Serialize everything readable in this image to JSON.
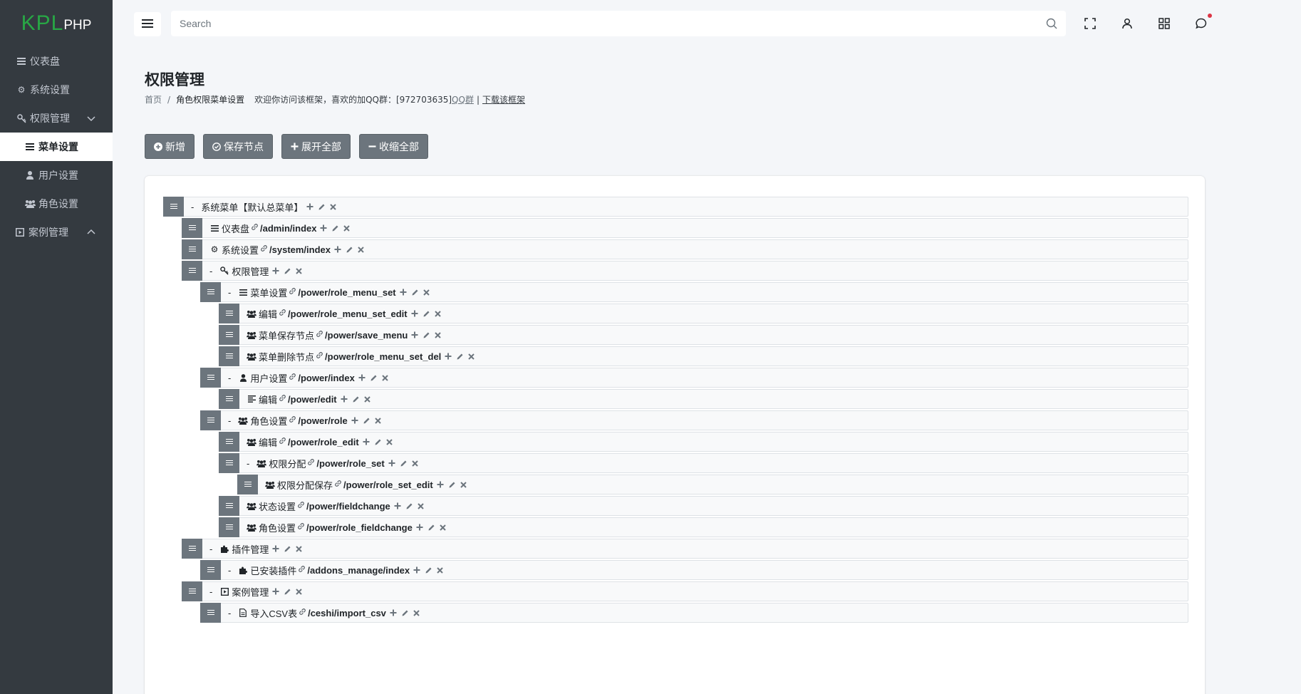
{
  "brand": {
    "kpl": "KPL",
    "php": "PHP"
  },
  "sidebar": {
    "items": [
      {
        "label": "仪表盘",
        "icon": "list-icon"
      },
      {
        "label": "系统设置",
        "icon": "gear-icon"
      },
      {
        "label": "权限管理",
        "icon": "key-icon",
        "expanded": true
      },
      {
        "label": "菜单设置",
        "icon": "list-icon",
        "active": true
      },
      {
        "label": "用户设置",
        "icon": "user-icon"
      },
      {
        "label": "角色设置",
        "icon": "users-icon"
      },
      {
        "label": "案例管理",
        "icon": "play-square-icon",
        "expanded": false
      }
    ]
  },
  "search": {
    "placeholder": "Search"
  },
  "page": {
    "title": "权限管理",
    "breadcrumb": {
      "home": "首页",
      "sep": "/",
      "current": "角色权限菜单设置",
      "notice": "欢迎你访问该框架，喜欢的加QQ群：[972703635]",
      "qq": "QQ群",
      "pipe": "|",
      "download": "下载该框架"
    }
  },
  "toolbar": {
    "add": "新增",
    "save": "保存节点",
    "expand": "展开全部",
    "collapse": "收缩全部"
  },
  "tree": [
    {
      "level": 0,
      "dash": true,
      "icon": "",
      "label": "系统菜单【默认总菜单】",
      "path": ""
    },
    {
      "level": 1,
      "dash": false,
      "icon": "list-icon",
      "label": "仪表盘",
      "path": "/admin/index"
    },
    {
      "level": 1,
      "dash": false,
      "icon": "gear-icon",
      "label": "系统设置",
      "path": "/system/index"
    },
    {
      "level": 1,
      "dash": true,
      "icon": "key-icon",
      "label": "权限管理",
      "path": ""
    },
    {
      "level": 2,
      "dash": true,
      "icon": "list-icon",
      "label": "菜单设置",
      "path": "/power/role_menu_set"
    },
    {
      "level": 3,
      "dash": false,
      "icon": "users-icon",
      "label": "编辑",
      "path": "/power/role_menu_set_edit"
    },
    {
      "level": 3,
      "dash": false,
      "icon": "users-icon",
      "label": "菜单保存节点",
      "path": "/power/save_menu"
    },
    {
      "level": 3,
      "dash": false,
      "icon": "users-icon",
      "label": "菜单删除节点",
      "path": "/power/role_menu_set_del"
    },
    {
      "level": 2,
      "dash": true,
      "icon": "user-icon",
      "label": "用户设置",
      "path": "/power/index"
    },
    {
      "level": 3,
      "dash": false,
      "icon": "align-left-icon",
      "label": "编辑",
      "path": "/power/edit"
    },
    {
      "level": 2,
      "dash": true,
      "icon": "users-icon",
      "label": "角色设置",
      "path": "/power/role"
    },
    {
      "level": 3,
      "dash": false,
      "icon": "users-icon",
      "label": "编辑",
      "path": "/power/role_edit"
    },
    {
      "level": 3,
      "dash": true,
      "icon": "users-icon",
      "label": "权限分配",
      "path": "/power/role_set"
    },
    {
      "level": 4,
      "dash": false,
      "icon": "users-icon",
      "label": "权限分配保存",
      "path": "/power/role_set_edit"
    },
    {
      "level": 3,
      "dash": false,
      "icon": "users-icon",
      "label": "状态设置",
      "path": "/power/fieldchange"
    },
    {
      "level": 3,
      "dash": false,
      "icon": "users-icon",
      "label": "角色设置",
      "path": "/power/role_fieldchange"
    },
    {
      "level": 1,
      "dash": true,
      "icon": "puzzle-icon",
      "label": "插件管理",
      "path": ""
    },
    {
      "level": 2,
      "dash": true,
      "icon": "puzzle-icon",
      "label": "已安装插件",
      "path": "/addons_manage/index"
    },
    {
      "level": 1,
      "dash": true,
      "icon": "play-square-icon",
      "label": "案例管理",
      "path": ""
    },
    {
      "level": 2,
      "dash": true,
      "icon": "file-icon",
      "label": "导入CSV表",
      "path": "/ceshi/import_csv"
    }
  ]
}
